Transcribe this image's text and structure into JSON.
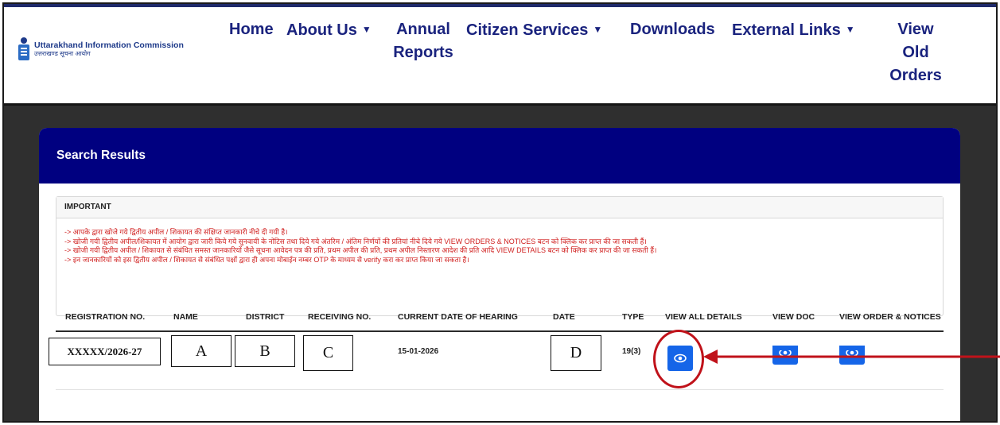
{
  "header": {
    "logo": {
      "name_en": "Uttarakhand Information Commission",
      "name_hi": "उत्तराखण्ड सूचना आयोग"
    },
    "nav": [
      {
        "label": "Home"
      },
      {
        "label": "About Us",
        "dropdown": true
      },
      {
        "label_line1": "Annual",
        "label_line2": "Reports"
      },
      {
        "label": "Citizen Services",
        "dropdown": true
      },
      {
        "label": "Downloads"
      },
      {
        "label": "External Links",
        "dropdown": true
      },
      {
        "label_line1": "View",
        "label_line2": "Old",
        "label_line3": "Orders"
      }
    ]
  },
  "card": {
    "title": "Search Results",
    "important": {
      "heading": "IMPORTANT",
      "lines": [
        "-> आपके द्वारा खोजे गये द्वितीय अपील / शिकायत की संक्षिप्त जानकारी नीचे दी गयी है।",
        "-> खोजी गयी द्वितीय अपील/शिकायत में आयोग द्वारा जारी किये गये सुनवायी के नोटिस तथा दिये गये अंतरिम / अंतिम निर्णयों की प्रतियां नीचे दिये गये VIEW ORDERS & NOTICES बटन को क्लिक कर प्राप्त की जा सकती हैं।",
        "-> खोजी गयी द्वितीय अपील / शिकायत से संबंधित समस्त जानकारियों जैसे सूचना आवेदन पत्र की प्रति, प्रथम अपील की प्रति, प्रथम अपील निस्तारण आदेश की प्रति आदि VIEW DETAILS बटन को क्लिक कर प्राप्त की जा सकती हैं।",
        "-> इन जानकारियों को इस द्वितीय अपील / शिकायत से संबंधित पक्षों द्वारा ही अपना मोबाईन नम्बर OTP के माध्यम से verify करा कर प्राप्त किया जा सकता है।"
      ]
    },
    "table": {
      "headers": {
        "registration_no": "REGISTRATION NO.",
        "name": "NAME",
        "district": "DISTRICT",
        "receiving_no": "RECEIVING NO.",
        "current_date_of_hearing": "CURRENT DATE OF HEARING",
        "date": "DATE",
        "type": "TYPE",
        "view_all_details": "VIEW ALL DETAILS",
        "view_doc": "VIEW DOC",
        "view_order_notices": "VIEW ORDER & NOTICES"
      },
      "row": {
        "registration_no": "XXXXX/2026-27",
        "name": "A",
        "district": "B",
        "receiving_no": "C",
        "current_date_of_hearing": "15-01-2026",
        "date": "D",
        "type": "19(3)"
      }
    }
  },
  "icons": {
    "view_button": "eye-icon"
  },
  "colors": {
    "nav_text": "#1a237e",
    "card_header_bg": "#000080",
    "notice_text": "#d0201f",
    "button_bg": "#1565e8",
    "annotation": "#c0121a"
  }
}
